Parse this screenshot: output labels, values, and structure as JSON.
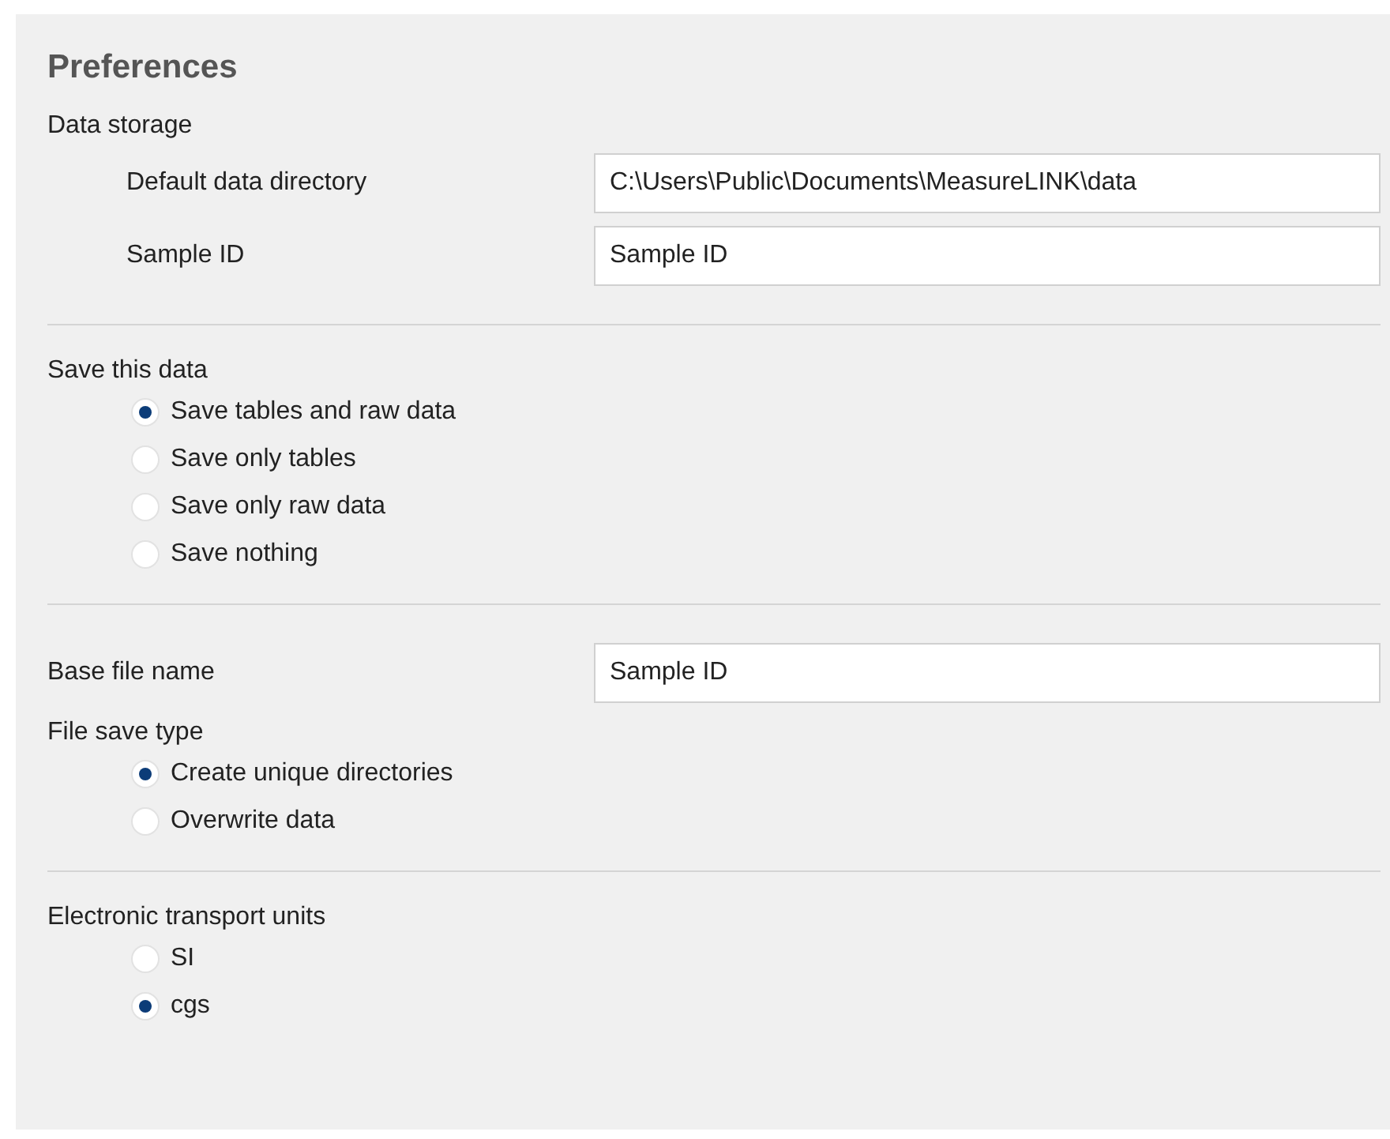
{
  "title": "Preferences",
  "sections": [
    [
      {
        "kind": "group",
        "label": "Data storage",
        "fields": [
          {
            "label": "Default data directory",
            "value": "C:\\Users\\Public\\Documents\\MeasureLINK\\data"
          },
          {
            "label": "Sample ID",
            "value": "Sample ID"
          }
        ]
      }
    ],
    [
      {
        "kind": "group",
        "label": "Save this data",
        "options": [
          {
            "label": "Save tables and raw data",
            "selected": true
          },
          {
            "label": "Save only tables",
            "selected": false
          },
          {
            "label": "Save only raw data",
            "selected": false
          },
          {
            "label": "Save nothing",
            "selected": false
          }
        ]
      }
    ],
    [
      {
        "kind": "field",
        "label": "Base file name",
        "value": "Sample ID"
      },
      {
        "kind": "group",
        "label": "File save type",
        "options": [
          {
            "label": "Create unique directories",
            "selected": true
          },
          {
            "label": "Overwrite data",
            "selected": false
          }
        ]
      }
    ],
    [
      {
        "kind": "group",
        "label": "Electronic transport units",
        "options": [
          {
            "label": "SI",
            "selected": false
          },
          {
            "label": "cgs",
            "selected": true
          }
        ]
      }
    ]
  ]
}
